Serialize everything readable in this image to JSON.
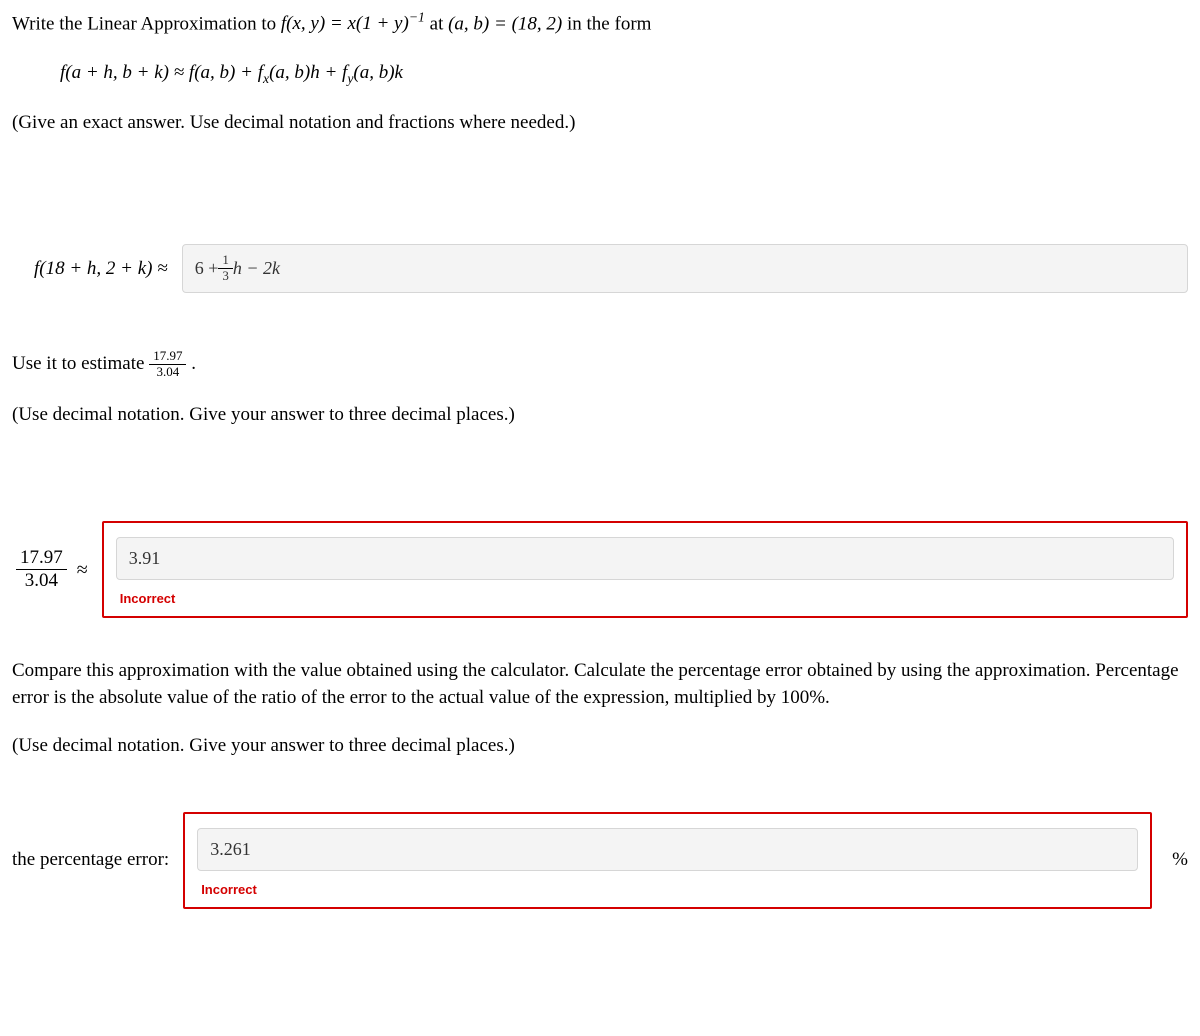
{
  "q1": {
    "prompt_pre": "Write the Linear Approximation to ",
    "func_lhs": "f(x, y) = x(1 + y)",
    "exp": "−1",
    "at_text": " at ",
    "point": "(a, b) = (18, 2)",
    "in_form": " in the form",
    "formula": "f(a + h, b + k) ≈ f(a, b) + f",
    "sub_x": "x",
    "mid1": "(a, b)h + f",
    "sub_y": "y",
    "mid2": "(a, b)k",
    "instr": "(Give an exact answer. Use decimal notation and fractions where needed.)",
    "lhs": "f(18 + h, 2 + k) ≈",
    "ans_pre": "6 + ",
    "ans_frac_num": "1",
    "ans_frac_den": "3",
    "ans_post": "h − 2k"
  },
  "q2": {
    "prompt_pre": "Use it to estimate ",
    "frac_num": "17.97",
    "frac_den": "3.04",
    "period": ".",
    "instr": "(Use decimal notation. Give your answer to three decimal places.)",
    "lhs_num": "17.97",
    "lhs_den": "3.04",
    "approx": "≈",
    "answer": "3.91",
    "feedback": "Incorrect"
  },
  "q3": {
    "para": "Compare this approximation with the value obtained using the calculator. Calculate the percentage error obtained by using the approximation. Percentage error is the absolute value of the ratio of the error to the actual value of the expression, multiplied by 100%.",
    "instr": "(Use decimal notation. Give your answer to three decimal places.)",
    "label": "the percentage error:",
    "answer": "3.261",
    "suffix": "%",
    "feedback": "Incorrect"
  }
}
